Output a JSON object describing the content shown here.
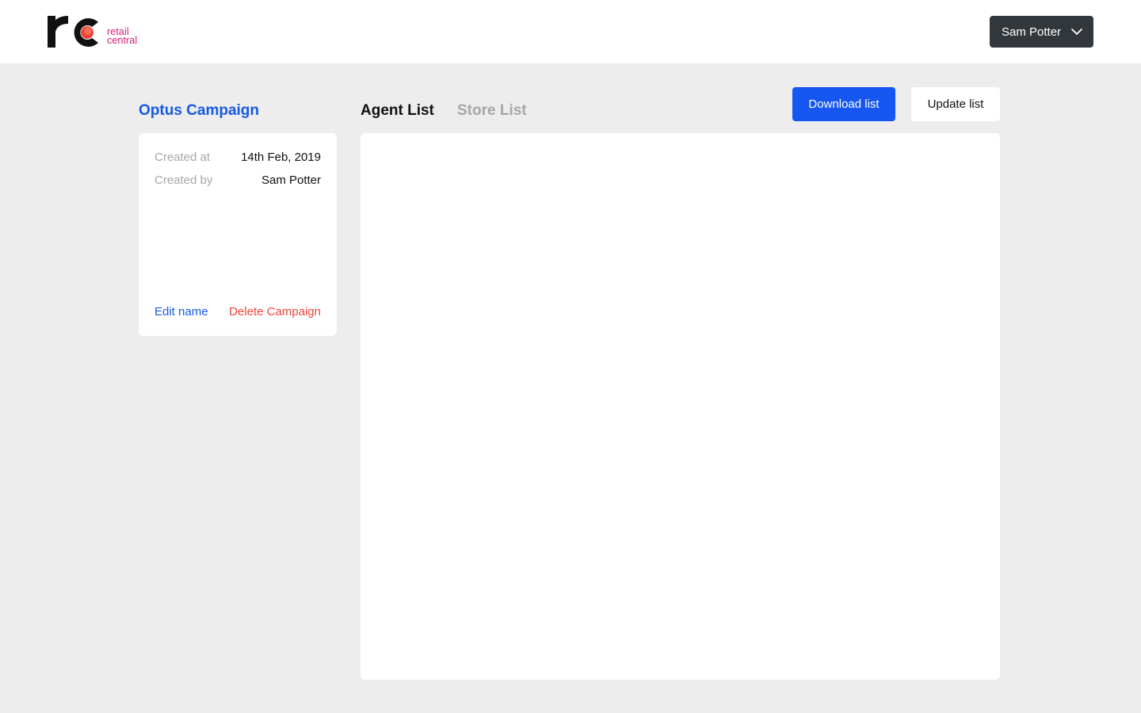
{
  "header": {
    "logo": {
      "mark": "rc",
      "line1": "retail",
      "line2": "central",
      "brand_color": "#d81b7a",
      "dot_color": "#f0433a"
    },
    "user_menu": {
      "name": "Sam Potter",
      "icon": "chevron-down-icon"
    }
  },
  "campaign": {
    "title": "Optus Campaign",
    "details": [
      {
        "label": "Created at",
        "value": "14th Feb, 2019"
      },
      {
        "label": "Created by",
        "value": "Sam Potter"
      }
    ],
    "edit_label": "Edit name",
    "delete_label": "Delete Campaign"
  },
  "tabs": [
    {
      "label": "Agent List",
      "active": true
    },
    {
      "label": "Store List",
      "active": false
    }
  ],
  "actions": {
    "download_label": "Download list",
    "update_label": "Update list"
  },
  "colors": {
    "accent": "#1557f0",
    "danger": "#f0433a",
    "muted": "#a6a6a6",
    "background": "#ededed",
    "dark_button": "#32373c"
  }
}
